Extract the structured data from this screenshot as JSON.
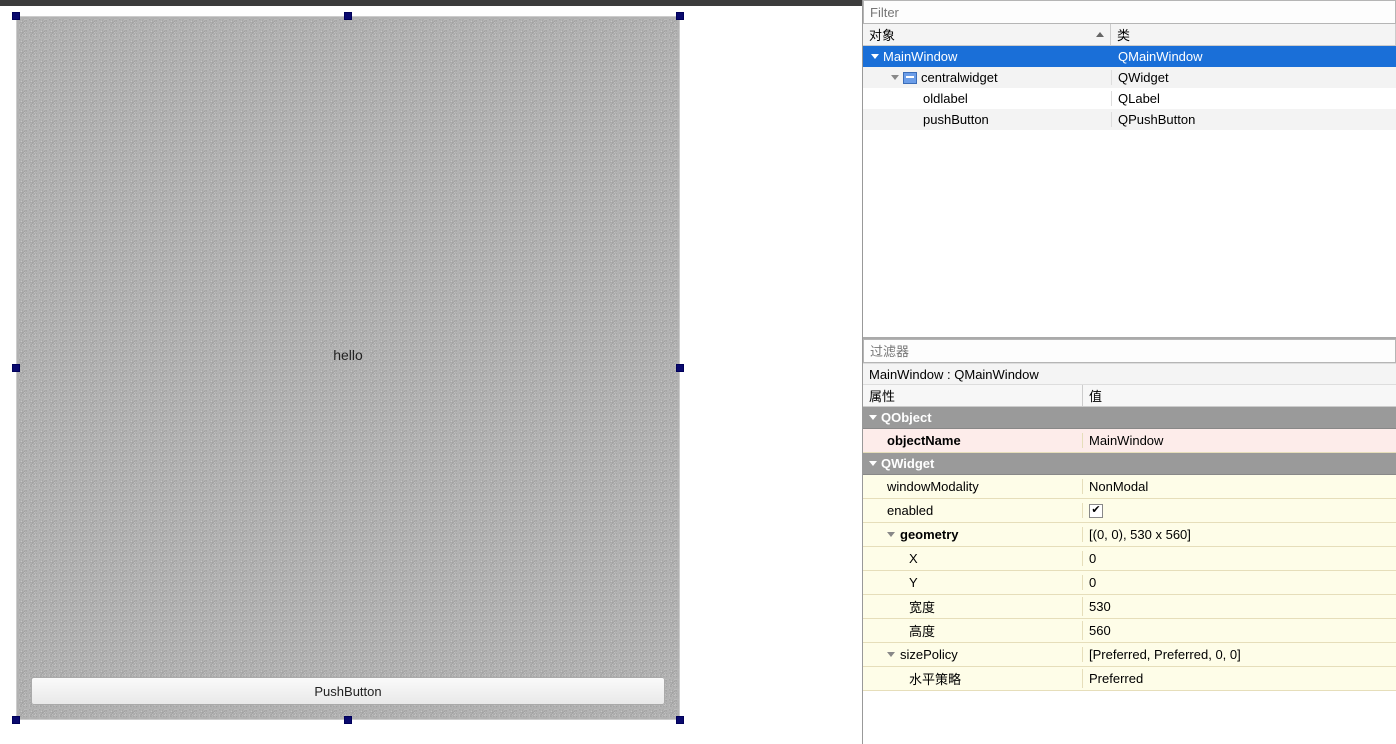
{
  "canvas": {
    "label_text": "hello",
    "button_text": "PushButton"
  },
  "object_inspector": {
    "filter_placeholder": "Filter",
    "columns": {
      "object": "对象",
      "class": "类"
    },
    "rows": [
      {
        "name": "MainWindow",
        "cls": "QMainWindow",
        "depth": 0,
        "expandable": true,
        "selected": true,
        "icon": false
      },
      {
        "name": "centralwidget",
        "cls": "QWidget",
        "depth": 1,
        "expandable": true,
        "selected": false,
        "icon": true
      },
      {
        "name": "oldlabel",
        "cls": "QLabel",
        "depth": 2,
        "expandable": false,
        "selected": false,
        "icon": false
      },
      {
        "name": "pushButton",
        "cls": "QPushButton",
        "depth": 2,
        "expandable": false,
        "selected": false,
        "icon": false
      }
    ]
  },
  "property_editor": {
    "filter_placeholder": "过滤器",
    "caption": "MainWindow : QMainWindow",
    "columns": {
      "name": "属性",
      "value": "值"
    },
    "items": [
      {
        "type": "group",
        "label": "QObject"
      },
      {
        "type": "prop",
        "name": "objectName",
        "value": "MainWindow",
        "tint": "pink",
        "indent": 0,
        "bold": true
      },
      {
        "type": "group",
        "label": "QWidget"
      },
      {
        "type": "prop",
        "name": "windowModality",
        "value": "NonModal",
        "tint": "yellow",
        "indent": 0
      },
      {
        "type": "prop",
        "name": "enabled",
        "value_kind": "check",
        "checked": true,
        "tint": "yellow",
        "indent": 0
      },
      {
        "type": "prop",
        "name": "geometry",
        "value": "[(0, 0), 530 x 560]",
        "tint": "yellow",
        "indent": 0,
        "expandable": true,
        "bold": true
      },
      {
        "type": "prop",
        "name": "X",
        "value": "0",
        "tint": "yellow",
        "indent": 1
      },
      {
        "type": "prop",
        "name": "Y",
        "value": "0",
        "tint": "yellow",
        "indent": 1
      },
      {
        "type": "prop",
        "name": "宽度",
        "value": "530",
        "tint": "yellow",
        "indent": 1
      },
      {
        "type": "prop",
        "name": "高度",
        "value": "560",
        "tint": "yellow",
        "indent": 1
      },
      {
        "type": "prop",
        "name": "sizePolicy",
        "value": "[Preferred, Preferred, 0, 0]",
        "tint": "yellow",
        "indent": 0,
        "expandable": true
      },
      {
        "type": "prop",
        "name": "水平策略",
        "value": "Preferred",
        "tint": "yellow",
        "indent": 1
      }
    ]
  }
}
